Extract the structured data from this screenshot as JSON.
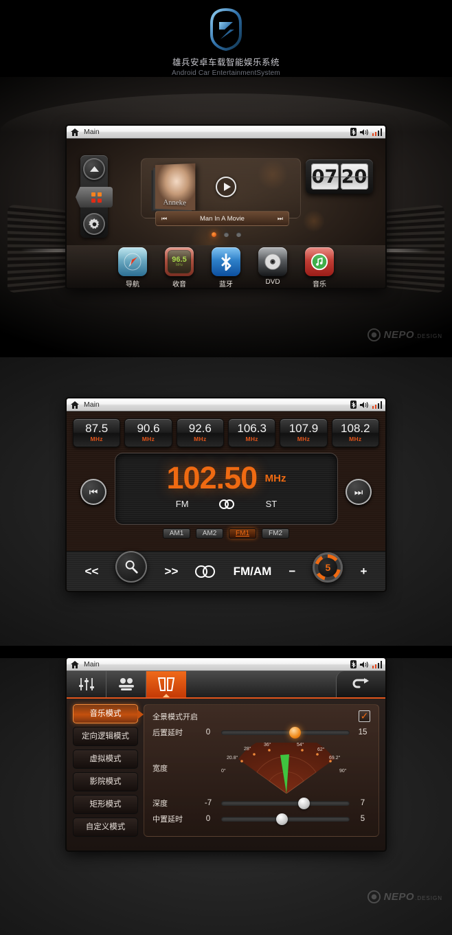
{
  "brand": {
    "title_cn": "雄兵安卓车载智能娱乐系统",
    "title_en": "Android Car EntertainmentSystem",
    "logo_icon": "shield-logo-icon",
    "logo_color": "#3f7fbf"
  },
  "watermark": {
    "name": "NEPO",
    "suffix": ".DESIGN",
    "icon": "nepo-logo-icon"
  },
  "status_bar": {
    "home_icon": "home-icon",
    "title": "Main",
    "bluetooth_icon": "bluetooth-icon",
    "volume_icon": "speaker-icon",
    "signal_icon": "signal-bars-icon"
  },
  "home": {
    "rail": {
      "up_icon": "chevron-up-circle-icon",
      "apps_icon": "grid-apps-icon",
      "settings_icon": "gear-icon"
    },
    "media": {
      "album_title": "Anneke",
      "track_title": "Man In A Movie",
      "prev_icon": "skip-previous-icon",
      "play_icon": "play-icon",
      "next_icon": "skip-next-icon"
    },
    "clock": {
      "hours": "07",
      "minutes": "20"
    },
    "pager": {
      "count": 3,
      "active": 0
    },
    "apps": [
      {
        "label": "导航",
        "icon": "compass-navigation-icon"
      },
      {
        "label": "收音",
        "icon": "radio-icon",
        "display": "96.5",
        "unit": "MHz"
      },
      {
        "label": "蓝牙",
        "icon": "bluetooth-icon"
      },
      {
        "label": "DVD",
        "icon": "disc-icon"
      },
      {
        "label": "音乐",
        "icon": "music-note-icon"
      }
    ]
  },
  "radio": {
    "presets": [
      {
        "freq": "87.5",
        "unit": "MHz"
      },
      {
        "freq": "90.6",
        "unit": "MHz"
      },
      {
        "freq": "92.6",
        "unit": "MHz"
      },
      {
        "freq": "106.3",
        "unit": "MHz"
      },
      {
        "freq": "107.9",
        "unit": "MHz"
      },
      {
        "freq": "108.2",
        "unit": "MHz"
      }
    ],
    "current": {
      "frequency": "102.50",
      "unit": "MHz",
      "band": "FM",
      "stereo_label": "ST",
      "stereo_icon": "stereo-icon"
    },
    "prev_icon": "skip-previous-icon",
    "next_icon": "skip-next-icon",
    "bands": [
      {
        "label": "AM1",
        "active": false
      },
      {
        "label": "AM2",
        "active": false
      },
      {
        "label": "FM1",
        "active": true
      },
      {
        "label": "FM2",
        "active": false
      }
    ],
    "controls": {
      "rewind": "<<",
      "scan_icon": "search-icon",
      "forward": ">>",
      "stereo_icon": "stereo-icon",
      "band_toggle": "FM/AM",
      "minus": "−",
      "volume_value": "5",
      "plus": "+"
    },
    "accent": "#ef6a12"
  },
  "audio": {
    "tabs": [
      {
        "name": "equalizer",
        "icon": "equalizer-sliders-icon",
        "active": false
      },
      {
        "name": "fader",
        "icon": "balance-fader-icon",
        "active": false
      },
      {
        "name": "surround",
        "icon": "surround-speakers-icon",
        "active": true
      }
    ],
    "return_icon": "return-arrow-icon",
    "modes": [
      {
        "label": "音乐模式",
        "active": true
      },
      {
        "label": "定向逻辑模式",
        "active": false
      },
      {
        "label": "虚拟模式",
        "active": false
      },
      {
        "label": "影院模式",
        "active": false
      },
      {
        "label": "矩形模式",
        "active": false
      },
      {
        "label": "自定义模式",
        "active": false
      }
    ],
    "panorama": {
      "label": "全景模式开启",
      "checked": true,
      "check_icon": "checkmark-icon"
    },
    "sliders": [
      {
        "label": "后置延时",
        "min": "0",
        "max": "15",
        "percent": 56,
        "thumb": "orange"
      },
      {
        "label": "深度",
        "min": "-7",
        "max": "7",
        "percent": 62,
        "thumb": "grey"
      },
      {
        "label": "中置延时",
        "min": "0",
        "max": "5",
        "percent": 45,
        "thumb": "grey"
      }
    ],
    "width_field": {
      "label": "宽度",
      "angle_labels": [
        "0°",
        "20.8°",
        "28°",
        "36°",
        "54°",
        "62°",
        "69.2°",
        "90°"
      ],
      "pointer_angle": "36°",
      "pointer_color": "#3fc43f"
    }
  }
}
